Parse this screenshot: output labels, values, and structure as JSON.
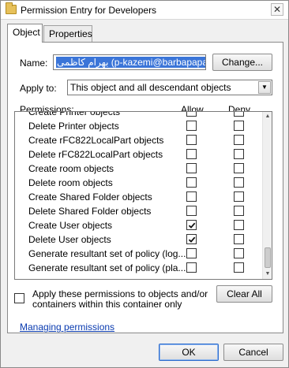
{
  "window": {
    "title": "Permission Entry for Developers",
    "close_glyph": "✕"
  },
  "tabs": [
    {
      "label": "Object",
      "active": true
    },
    {
      "label": "Properties",
      "active": false
    }
  ],
  "name": {
    "label": "Name:",
    "value": "بهرام کاظمی (p-kazemi@barbapapa.org)",
    "change_button": "Change..."
  },
  "apply_to": {
    "label": "Apply to:",
    "value": "This object and all descendant objects"
  },
  "permissions": {
    "header": "Permissions:",
    "allow_header": "Allow",
    "deny_header": "Deny",
    "rows": [
      {
        "name": "Create Printer objects",
        "allow": false,
        "deny": false
      },
      {
        "name": "Delete Printer objects",
        "allow": false,
        "deny": false
      },
      {
        "name": "Create rFC822LocalPart objects",
        "allow": false,
        "deny": false
      },
      {
        "name": "Delete rFC822LocalPart objects",
        "allow": false,
        "deny": false
      },
      {
        "name": "Create room objects",
        "allow": false,
        "deny": false
      },
      {
        "name": "Delete room objects",
        "allow": false,
        "deny": false
      },
      {
        "name": "Create Shared Folder objects",
        "allow": false,
        "deny": false
      },
      {
        "name": "Delete Shared Folder objects",
        "allow": false,
        "deny": false
      },
      {
        "name": "Create User objects",
        "allow": true,
        "deny": false
      },
      {
        "name": "Delete User objects",
        "allow": true,
        "deny": false
      },
      {
        "name": "Generate resultant set of policy (log...",
        "allow": false,
        "deny": false
      },
      {
        "name": "Generate resultant set of policy (pla...",
        "allow": false,
        "deny": false
      }
    ]
  },
  "apply_option": {
    "label_line1": "Apply these permissions to objects and/or",
    "label_line2": "containers within this container only",
    "checked": false
  },
  "clear_all_button": "Clear All",
  "managing_link": "Managing permissions",
  "ok_button": "OK",
  "cancel_button": "Cancel",
  "icons": {
    "title": "folder-icon",
    "combo": "chevron-down-icon",
    "scroll_up": "arrow-up-icon",
    "scroll_down": "arrow-down-icon",
    "check": "checkmark-icon"
  }
}
